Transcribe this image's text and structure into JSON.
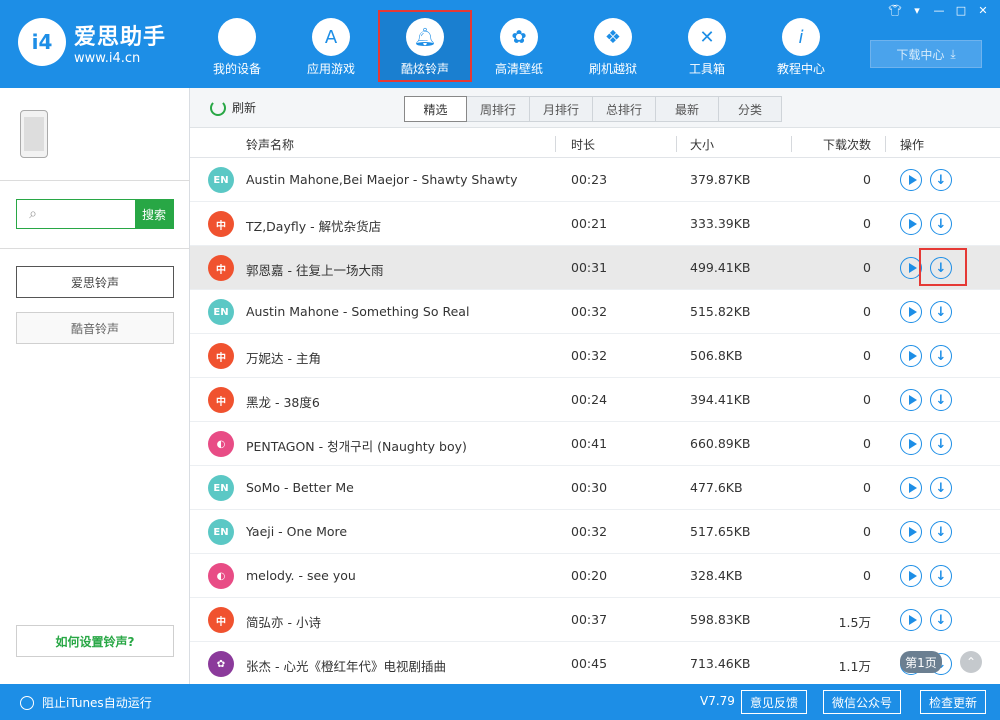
{
  "app": {
    "logo_mark": "i4",
    "logo_title": "爱思助手",
    "logo_url": "www.i4.cn"
  },
  "nav": [
    {
      "label": "我的设备",
      "icon": "apple-icon"
    },
    {
      "label": "应用游戏",
      "icon": "app-store-icon"
    },
    {
      "label": "酷炫铃声",
      "icon": "bell-icon"
    },
    {
      "label": "高清壁纸",
      "icon": "flower-icon"
    },
    {
      "label": "刷机越狱",
      "icon": "dropbox-icon"
    },
    {
      "label": "工具箱",
      "icon": "tools-icon"
    },
    {
      "label": "教程中心",
      "icon": "info-icon"
    }
  ],
  "window_controls": [
    "shirt",
    "menu",
    "minimize",
    "maximize",
    "close"
  ],
  "download_center": "下载中心",
  "sidebar": {
    "search_button": "搜索",
    "buttons": [
      "爱思铃声",
      "酷音铃声"
    ],
    "help": "如何设置铃声?"
  },
  "toolbar": {
    "refresh": "刷新",
    "tabs": [
      "精选",
      "周排行",
      "月排行",
      "总排行",
      "最新",
      "分类"
    ]
  },
  "table": {
    "headers": {
      "name": "铃声名称",
      "duration": "时长",
      "size": "大小",
      "downloads": "下载次数",
      "actions": "操作"
    },
    "rows": [
      {
        "badge": "EN",
        "name": "Austin Mahone,Bei Maejor - Shawty Shawty",
        "duration": "00:23",
        "size": "379.87KB",
        "downloads": "0"
      },
      {
        "badge": "中",
        "name": "TZ,Dayfly - 解忧杂货店",
        "duration": "00:21",
        "size": "333.39KB",
        "downloads": "0"
      },
      {
        "badge": "中",
        "name": "郭恩嘉 - 往复上一场大雨",
        "duration": "00:31",
        "size": "499.41KB",
        "downloads": "0"
      },
      {
        "badge": "EN",
        "name": "Austin Mahone - Something So Real",
        "duration": "00:32",
        "size": "515.82KB",
        "downloads": "0"
      },
      {
        "badge": "中",
        "name": "万妮达 - 主角",
        "duration": "00:32",
        "size": "506.8KB",
        "downloads": "0"
      },
      {
        "badge": "中",
        "name": "黑龙 - 38度6",
        "duration": "00:24",
        "size": "394.41KB",
        "downloads": "0"
      },
      {
        "badge": "◐",
        "name": "PENTAGON - 청개구리 (Naughty boy)",
        "duration": "00:41",
        "size": "660.89KB",
        "downloads": "0"
      },
      {
        "badge": "EN",
        "name": "SoMo - Better Me",
        "duration": "00:30",
        "size": "477.6KB",
        "downloads": "0"
      },
      {
        "badge": "EN",
        "name": "Yaeji - One More",
        "duration": "00:32",
        "size": "517.65KB",
        "downloads": "0"
      },
      {
        "badge": "◐",
        "name": "melody. - see you",
        "duration": "00:20",
        "size": "328.4KB",
        "downloads": "0"
      },
      {
        "badge": "中",
        "name": "简弘亦 - 小诗",
        "duration": "00:37",
        "size": "598.83KB",
        "downloads": "1.5万"
      },
      {
        "badge": "✿",
        "name": "张杰 - 心光《橙红年代》电视剧插曲",
        "duration": "00:45",
        "size": "713.46KB",
        "downloads": "1.1万"
      }
    ]
  },
  "page_indicator": "第1页",
  "status": {
    "itunes": "阻止iTunes自动运行",
    "version": "V7.79",
    "buttons": [
      "意见反馈",
      "微信公众号",
      "检查更新"
    ]
  },
  "colors": {
    "brand_blue": "#1d8ee6",
    "green": "#28a745",
    "highlight_red": "#e53935",
    "en_badge": "#5bc8c5",
    "zh_badge": "#f0522f",
    "kr_badge": "#e84c85",
    "misc_badge": "#8b3a9b"
  }
}
